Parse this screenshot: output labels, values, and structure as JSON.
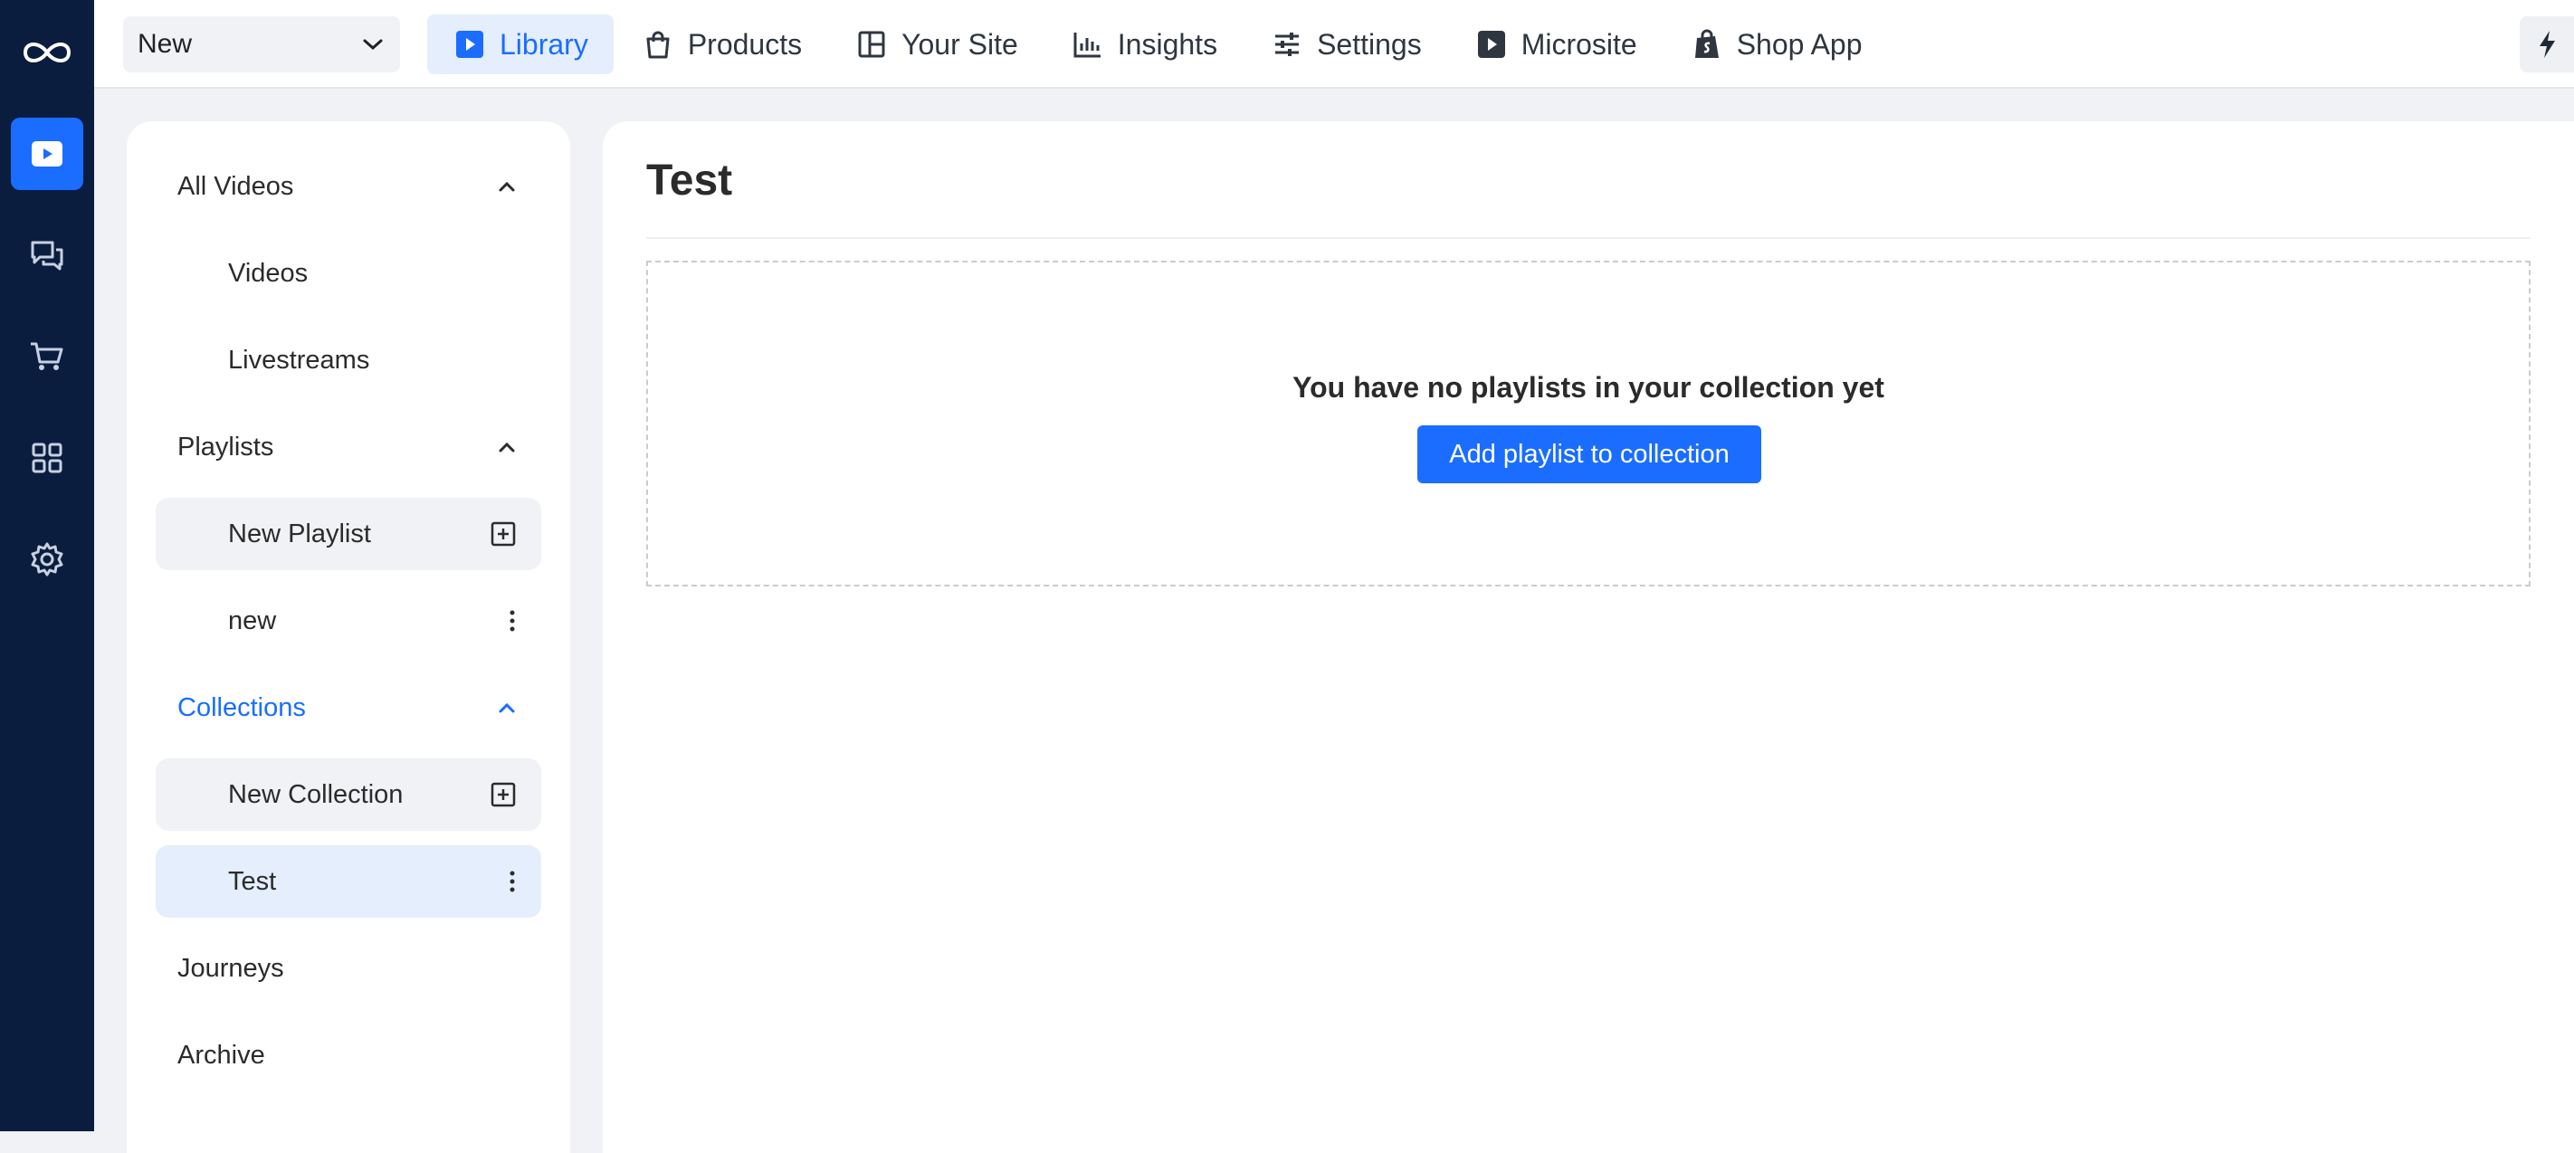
{
  "topbar": {
    "select_value": "New",
    "nav": [
      {
        "label": "Library",
        "icon": "play-square-icon"
      },
      {
        "label": "Products",
        "icon": "shopping-bag-icon"
      },
      {
        "label": "Your Site",
        "icon": "layout-icon"
      },
      {
        "label": "Insights",
        "icon": "bar-chart-icon"
      },
      {
        "label": "Settings",
        "icon": "sliders-icon"
      },
      {
        "label": "Microsite",
        "icon": "play-square-icon"
      },
      {
        "label": "Shop App",
        "icon": "shopify-bag-icon"
      }
    ]
  },
  "rail": {
    "items": [
      "logo-icon",
      "video-icon",
      "chat-icon",
      "cart-icon",
      "grid-icon",
      "gear-icon"
    ]
  },
  "sidebar": {
    "all_videos": "All Videos",
    "videos": "Videos",
    "livestreams": "Livestreams",
    "playlists": "Playlists",
    "new_playlist": "New Playlist",
    "playlist_new": "new",
    "collections": "Collections",
    "new_collection": "New Collection",
    "collection_test": "Test",
    "journeys": "Journeys",
    "archive": "Archive"
  },
  "main": {
    "title": "Test",
    "empty_message": "You have no playlists in your collection yet",
    "add_button": "Add playlist to collection"
  },
  "colors": {
    "accent": "#1a6dff",
    "rail": "#0b1d3f",
    "active_bg": "#e4eefc"
  }
}
